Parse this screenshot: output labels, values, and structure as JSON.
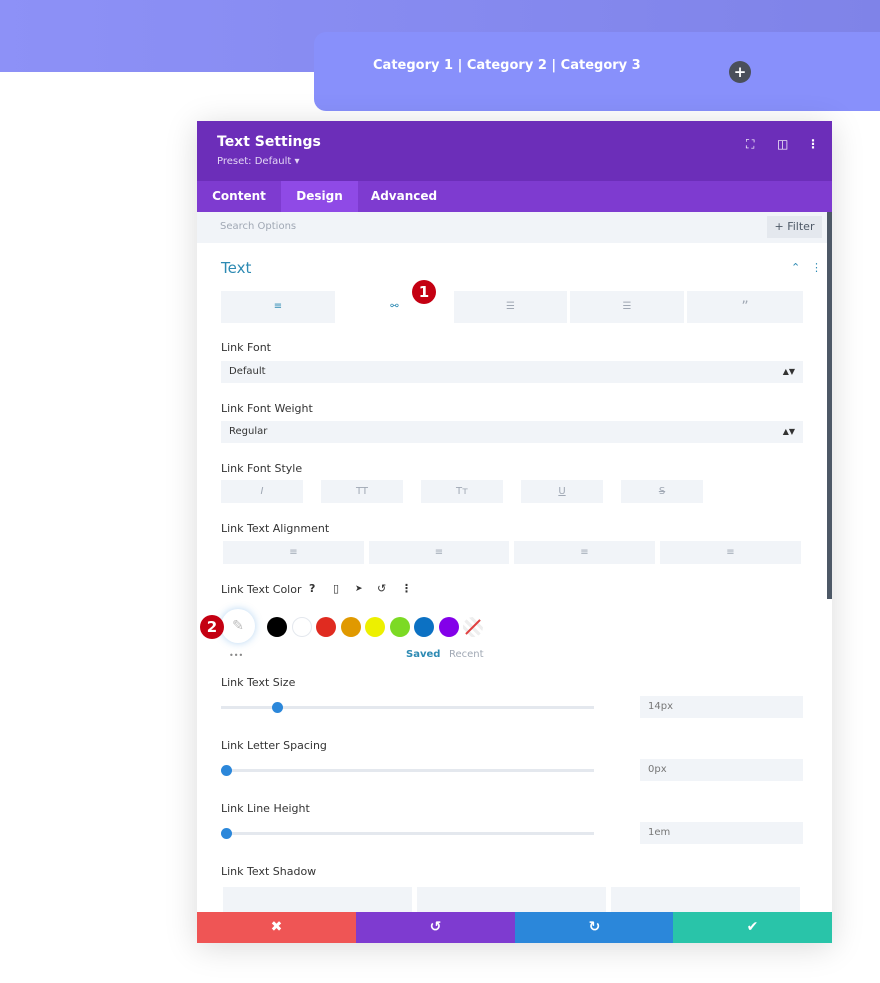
{
  "background": {
    "categories": "Category 1 | Category 2 | Category 3",
    "add_icon": "plus-icon"
  },
  "panel": {
    "title": "Text Settings",
    "preset": "Preset: Default ▾",
    "header_icons": [
      "expand-icon",
      "sidebar-icon",
      "more-icon"
    ],
    "tabs": [
      {
        "label": "Content"
      },
      {
        "label": "Design",
        "active": true
      },
      {
        "label": "Advanced"
      }
    ],
    "search_placeholder": "Search Options",
    "filter_label": "+ Filter",
    "section_title": "Text",
    "subtabs": [
      "text-align-icon",
      "link-icon",
      "unordered-list-icon",
      "ordered-list-icon",
      "quote-icon"
    ],
    "link_font": {
      "label": "Link Font",
      "value": "Default"
    },
    "link_font_weight": {
      "label": "Link Font Weight",
      "value": "Regular"
    },
    "link_font_style": {
      "label": "Link Font Style",
      "options": [
        "I",
        "TT",
        "Tт",
        "U",
        "S"
      ]
    },
    "link_text_alignment": {
      "label": "Link Text Alignment"
    },
    "link_text_color": {
      "label": "Link Text Color",
      "icons": [
        "?",
        "▯",
        "➤",
        "↺",
        "⋮"
      ],
      "swatches": [
        "#000000",
        "#ffffff",
        "#e02b20",
        "#e09900",
        "#edf000",
        "#7cda24",
        "#0c71c3",
        "#8300e9"
      ],
      "saved": "Saved",
      "recent": "Recent",
      "more": "•••"
    },
    "link_text_size": {
      "label": "Link Text Size",
      "value": "14px",
      "fraction": 0.14
    },
    "link_letter_spacing": {
      "label": "Link Letter Spacing",
      "value": "0px",
      "fraction": 0
    },
    "link_line_height": {
      "label": "Link Line Height",
      "value": "1em",
      "fraction": 0
    },
    "link_text_shadow": {
      "label": "Link Text Shadow"
    },
    "badges": [
      "1",
      "2"
    ],
    "footer": {
      "cancel": "✖",
      "undo": "↺",
      "redo": "↻",
      "save": "✔"
    },
    "colors": {
      "header": "#6c2eb9",
      "tabs": "#7e3bd0",
      "accent": "#2b87da",
      "cancel": "#ef5555",
      "undo": "#7e3bd0",
      "redo": "#2b87da",
      "save": "#29c4a9"
    }
  }
}
